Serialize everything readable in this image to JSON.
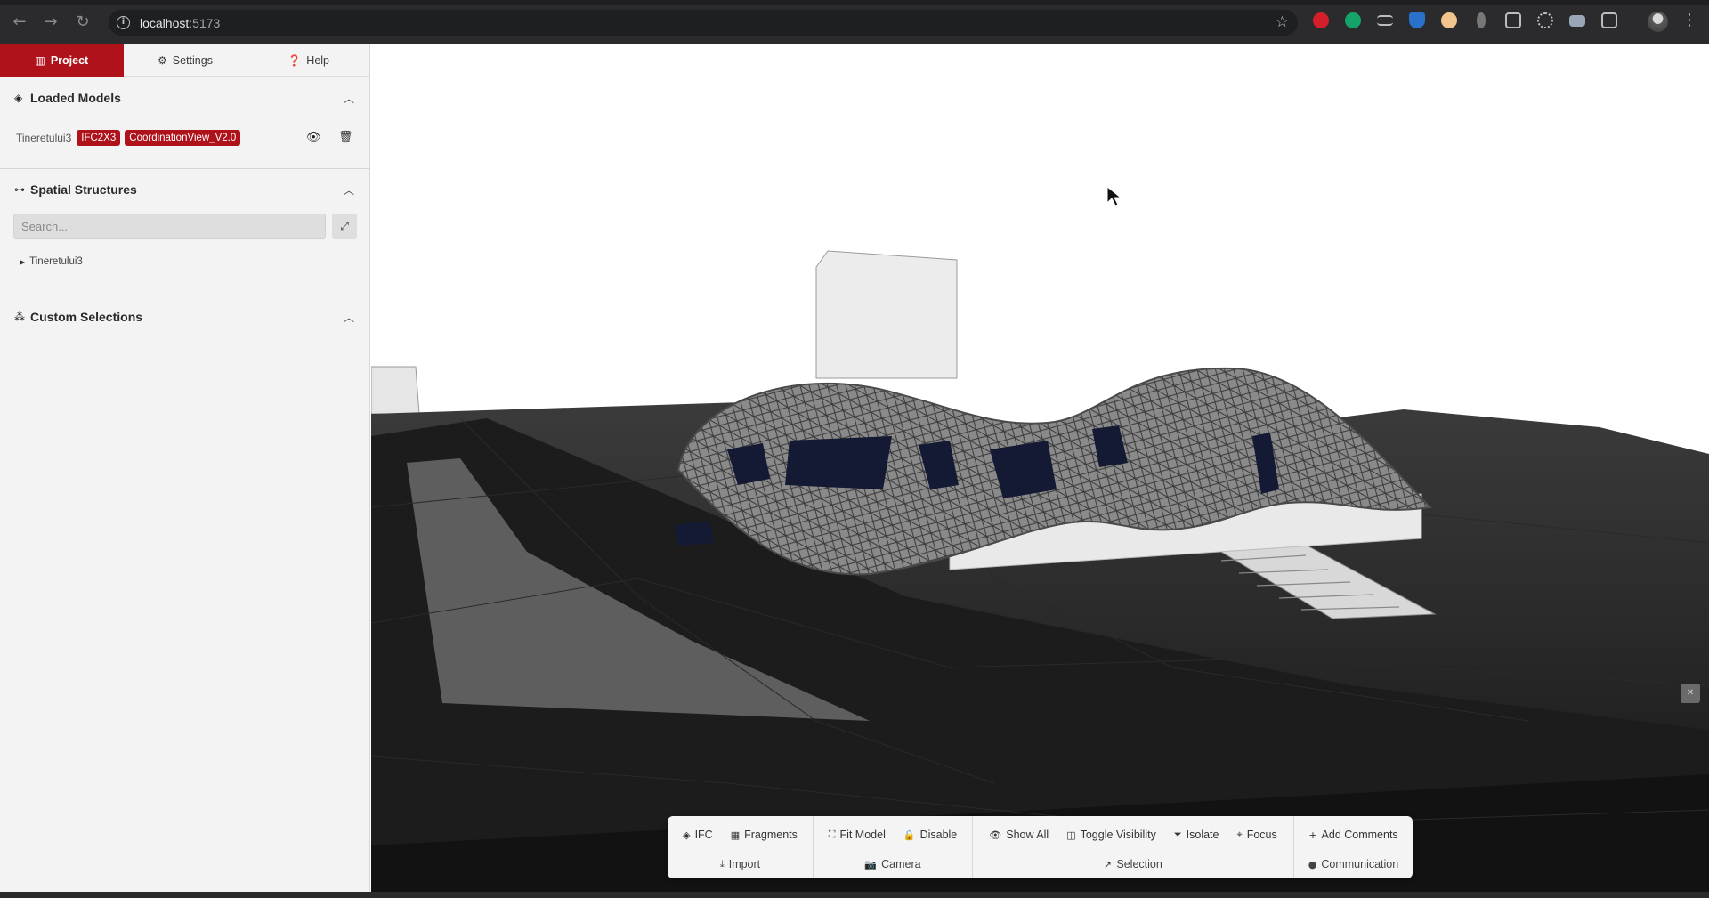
{
  "browser": {
    "url_host": "localhost",
    "url_port": ":5173",
    "nav": {
      "back_icon": "arrow-left-icon",
      "forward_icon": "arrow-right-icon",
      "reload_icon": "reload-icon"
    }
  },
  "sidebar": {
    "tabs": [
      {
        "label": "Project",
        "icon": "building-icon",
        "active": true
      },
      {
        "label": "Settings",
        "icon": "gear-icon",
        "active": false
      },
      {
        "label": "Help",
        "icon": "help-icon",
        "active": false
      }
    ],
    "loaded_models": {
      "title": "Loaded Models",
      "model": {
        "name": "Tineretului3",
        "tags": [
          "IFC2X3",
          "CoordinationView_V2.0"
        ]
      }
    },
    "spatial_structures": {
      "title": "Spatial Structures",
      "search_placeholder": "Search...",
      "tree_item": "Tineretului3"
    },
    "custom_selections": {
      "title": "Custom Selections"
    }
  },
  "toolbar": {
    "groups": [
      {
        "label": "Import",
        "label_icon": "download-icon",
        "buttons": [
          {
            "label": "IFC",
            "icon": "cube-icon"
          },
          {
            "label": "Fragments",
            "icon": "grid-icon"
          }
        ]
      },
      {
        "label": "Camera",
        "label_icon": "camera-icon",
        "buttons": [
          {
            "label": "Fit Model",
            "icon": "fit-icon"
          },
          {
            "label": "Disable",
            "icon": "lock-icon"
          }
        ]
      },
      {
        "label": "Selection",
        "label_icon": "cursor-icon",
        "buttons": [
          {
            "label": "Show All",
            "icon": "eye-icon"
          },
          {
            "label": "Toggle Visibility",
            "icon": "toggle-icon"
          },
          {
            "label": "Isolate",
            "icon": "filter-icon"
          },
          {
            "label": "Focus",
            "icon": "focus-icon"
          }
        ]
      },
      {
        "label": "Communication",
        "label_icon": "chat-icon",
        "buttons": [
          {
            "label": "Add Comments",
            "icon": "plus-icon"
          }
        ]
      }
    ]
  },
  "colors": {
    "accent": "#b0121b",
    "chrome": "#2b2b2d",
    "panel": "#f3f3f3"
  }
}
